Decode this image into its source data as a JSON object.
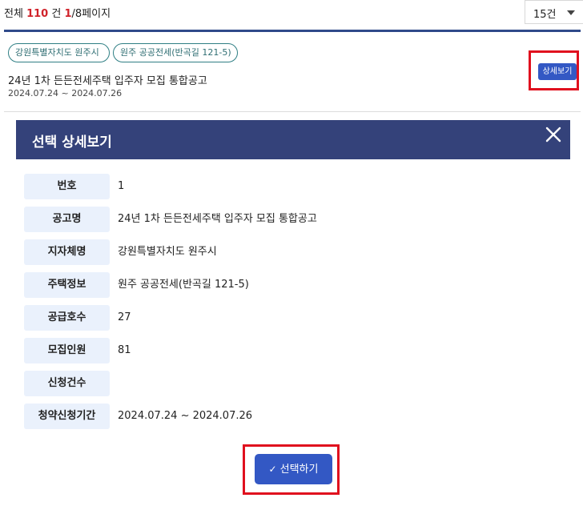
{
  "list_header": {
    "total_prefix": "전체",
    "total_count": "110",
    "total_unit": "건",
    "page_current": "1",
    "page_suffix": "/8페이지",
    "per_page": "15건"
  },
  "item": {
    "tags": [
      "강원특별자치도 원주시",
      "원주 공공전세(반곡길 121-5)"
    ],
    "title": "24년 1차 든든전세주택 입주자 모집 통합공고",
    "date": "2024.07.24 ~ 2024.07.26",
    "detail_button": "상세보기"
  },
  "modal": {
    "title": "선택 상세보기",
    "close_icon": "close-icon",
    "rows": [
      {
        "label": "번호",
        "value": "1"
      },
      {
        "label": "공고명",
        "value": "24년 1차 든든전세주택 입주자 모집 통합공고"
      },
      {
        "label": "지자체명",
        "value": "강원특별자치도 원주시"
      },
      {
        "label": "주택정보",
        "value": "원주 공공전세(반곡길 121-5)"
      },
      {
        "label": "공급호수",
        "value": "27"
      },
      {
        "label": "모집인원",
        "value": "81"
      },
      {
        "label": "신청건수",
        "value": ""
      },
      {
        "label": "청약신청기간",
        "value": "2024.07.24 ~ 2024.07.26"
      }
    ],
    "select_button": "선택하기",
    "select_icon": "check-icon"
  },
  "colors": {
    "accent_blue": "#3358c4",
    "modal_header": "#34427a",
    "highlight_red": "#e0101e",
    "count_red": "#d0222a",
    "label_bg": "#eaf1fc",
    "tag_border": "#2f7f84"
  }
}
